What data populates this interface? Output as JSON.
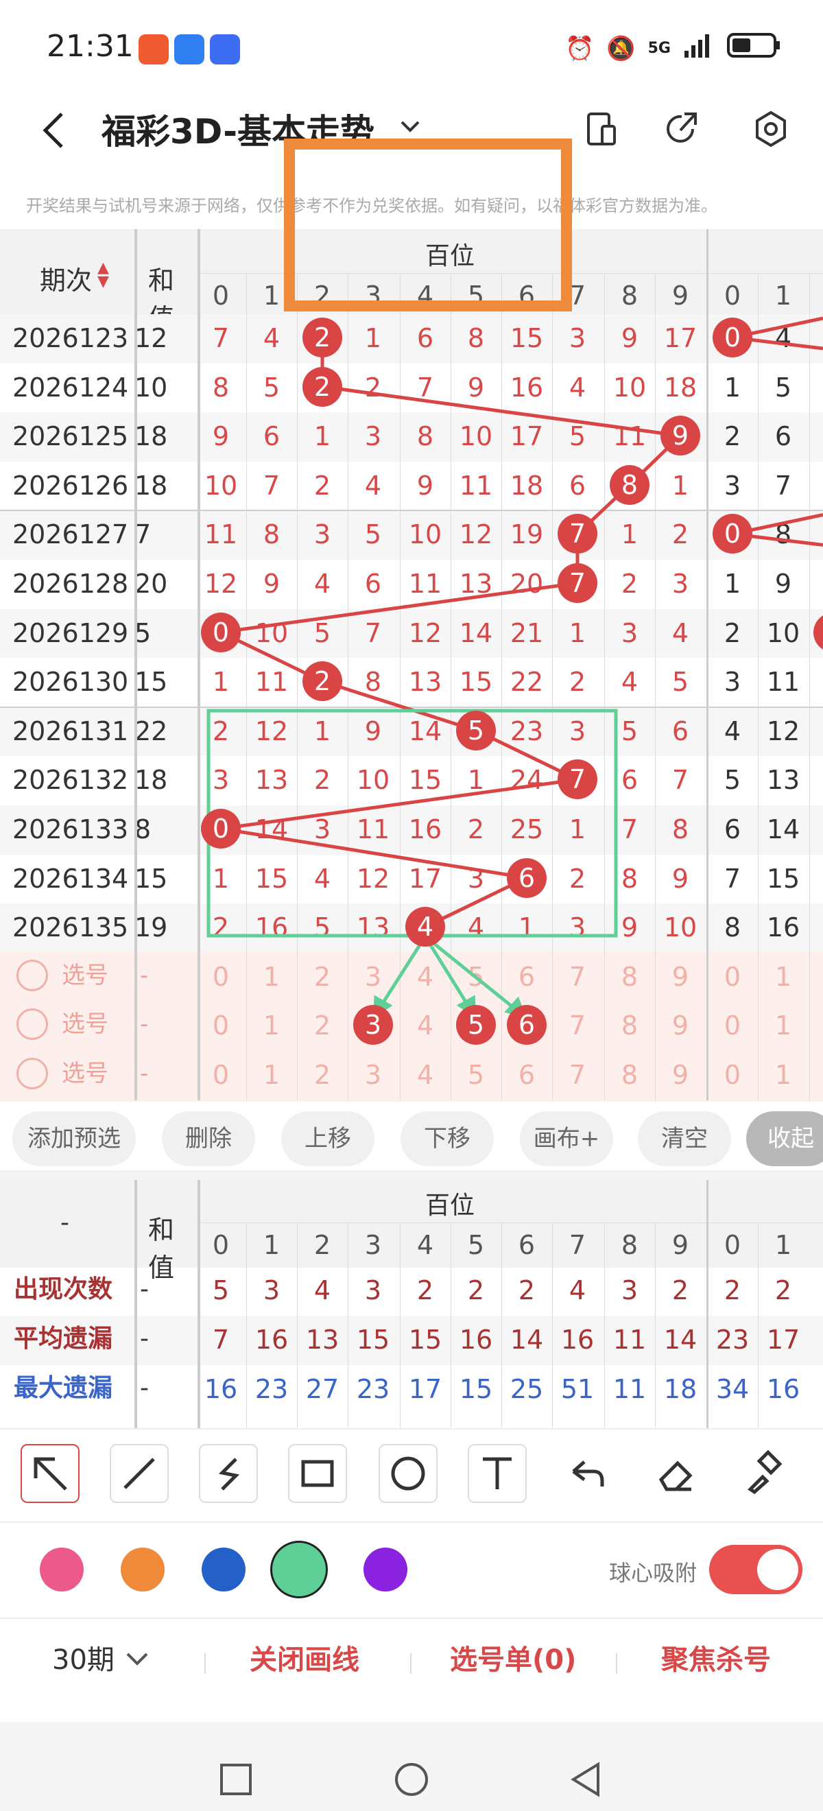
{
  "status": {
    "time": "21:31",
    "network": "5G"
  },
  "header": {
    "title": "福彩3D-基本走势",
    "notice": "开奖结果与试机号来源于网络，仅供参考不作为兑奖依据。如有疑问，以福体彩官方数据为准。"
  },
  "table": {
    "issue_header": "期次",
    "hezhi_header": "和值",
    "group_header": "百位",
    "digits": [
      "0",
      "1",
      "2",
      "3",
      "4",
      "5",
      "6",
      "7",
      "8",
      "9"
    ],
    "rows": [
      {
        "issue": "2026123",
        "hezhi": "12",
        "values": [
          "7",
          "4",
          "2",
          "1",
          "6",
          "8",
          "15",
          "3",
          "9",
          "17"
        ],
        "hit": 2,
        "extra": [
          "0",
          "4"
        ],
        "extra_hit": 0
      },
      {
        "issue": "2026124",
        "hezhi": "10",
        "values": [
          "8",
          "5",
          "2",
          "2",
          "7",
          "9",
          "16",
          "4",
          "10",
          "18"
        ],
        "hit": 2,
        "extra": [
          "1",
          "5"
        ],
        "extra_hit": -1
      },
      {
        "issue": "2026125",
        "hezhi": "18",
        "values": [
          "9",
          "6",
          "1",
          "3",
          "8",
          "10",
          "17",
          "5",
          "11",
          "9"
        ],
        "hit": 9,
        "extra": [
          "2",
          "6"
        ],
        "extra_hit": -1
      },
      {
        "issue": "2026126",
        "hezhi": "18",
        "values": [
          "10",
          "7",
          "2",
          "4",
          "9",
          "11",
          "18",
          "6",
          "8",
          "1"
        ],
        "hit": 8,
        "extra": [
          "3",
          "7"
        ],
        "extra_hit": -1
      },
      {
        "issue": "2026127",
        "hezhi": "7",
        "values": [
          "11",
          "8",
          "3",
          "5",
          "10",
          "12",
          "19",
          "7",
          "1",
          "2"
        ],
        "hit": 7,
        "extra": [
          "0",
          "8"
        ],
        "extra_hit": 0
      },
      {
        "issue": "2026128",
        "hezhi": "20",
        "values": [
          "12",
          "9",
          "4",
          "6",
          "11",
          "13",
          "20",
          "7",
          "2",
          "3"
        ],
        "hit": 7,
        "extra": [
          "1",
          "9"
        ],
        "extra_hit": -1
      },
      {
        "issue": "2026129",
        "hezhi": "5",
        "values": [
          "0",
          "10",
          "5",
          "7",
          "12",
          "14",
          "21",
          "1",
          "3",
          "4"
        ],
        "hit": 0,
        "extra": [
          "2",
          "10"
        ],
        "extra_hit": -1
      },
      {
        "issue": "2026130",
        "hezhi": "15",
        "values": [
          "1",
          "11",
          "2",
          "8",
          "13",
          "15",
          "22",
          "2",
          "4",
          "5"
        ],
        "hit": 2,
        "extra": [
          "3",
          "11"
        ],
        "extra_hit": -1
      },
      {
        "issue": "2026131",
        "hezhi": "22",
        "values": [
          "2",
          "12",
          "1",
          "9",
          "14",
          "5",
          "23",
          "3",
          "5",
          "6"
        ],
        "hit": 5,
        "extra": [
          "4",
          "12"
        ],
        "extra_hit": -1
      },
      {
        "issue": "2026132",
        "hezhi": "18",
        "values": [
          "3",
          "13",
          "2",
          "10",
          "15",
          "1",
          "24",
          "7",
          "6",
          "7"
        ],
        "hit": 7,
        "extra": [
          "5",
          "13"
        ],
        "extra_hit": -1
      },
      {
        "issue": "2026133",
        "hezhi": "8",
        "values": [
          "0",
          "14",
          "3",
          "11",
          "16",
          "2",
          "25",
          "1",
          "7",
          "8"
        ],
        "hit": 0,
        "extra": [
          "6",
          "14"
        ],
        "extra_hit": -1
      },
      {
        "issue": "2026134",
        "hezhi": "15",
        "values": [
          "1",
          "15",
          "4",
          "12",
          "17",
          "3",
          "6",
          "2",
          "8",
          "9"
        ],
        "hit": 6,
        "extra": [
          "7",
          "15"
        ],
        "extra_hit": -1
      },
      {
        "issue": "2026135",
        "hezhi": "19",
        "values": [
          "2",
          "16",
          "5",
          "13",
          "4",
          "4",
          "1",
          "3",
          "9",
          "10"
        ],
        "hit": 4,
        "extra": [
          "8",
          "16"
        ],
        "extra_hit": -1
      }
    ],
    "pick_label": "选号",
    "pick_dash": "-",
    "picks": [
      {
        "selected": []
      },
      {
        "selected": [
          3,
          5,
          6
        ]
      },
      {
        "selected": []
      }
    ]
  },
  "toolbar": [
    "添加预选",
    "删除",
    "上移",
    "下移",
    "画布+",
    "清空",
    "收起"
  ],
  "stats": {
    "dash": "-",
    "group_header": "百位",
    "hezhi_header": "和值",
    "rows": [
      {
        "label": "出现次数",
        "color": "#a83232",
        "values": [
          "5",
          "3",
          "4",
          "3",
          "2",
          "2",
          "2",
          "4",
          "3",
          "2"
        ],
        "extra": [
          "2",
          "2"
        ]
      },
      {
        "label": "平均遗漏",
        "color": "#a83232",
        "values": [
          "7",
          "16",
          "13",
          "15",
          "15",
          "16",
          "14",
          "16",
          "11",
          "14"
        ],
        "extra": [
          "23",
          "17"
        ]
      },
      {
        "label": "最大遗漏",
        "color": "#3a64c8",
        "values": [
          "16",
          "23",
          "27",
          "23",
          "17",
          "15",
          "25",
          "51",
          "11",
          "18"
        ],
        "extra": [
          "34",
          "16"
        ]
      }
    ]
  },
  "colors": {
    "red": "#d94444",
    "green": "#5ecf96",
    "orange": "#ef8a3a",
    "pink": "#ec5a8c",
    "blue": "#2460c8",
    "purple": "#8a22e0"
  },
  "drawtools": [
    "arrow-icon",
    "line-icon",
    "curve-icon",
    "rect-icon",
    "circle-icon",
    "text-icon",
    "undo-icon",
    "eraser-icon",
    "brush-icon"
  ],
  "snap_label": "球心吸附",
  "bottom": {
    "periods": "30期",
    "close_lines": "关闭画线",
    "picklist": "选号单(0)",
    "focus": "聚焦杀号"
  }
}
